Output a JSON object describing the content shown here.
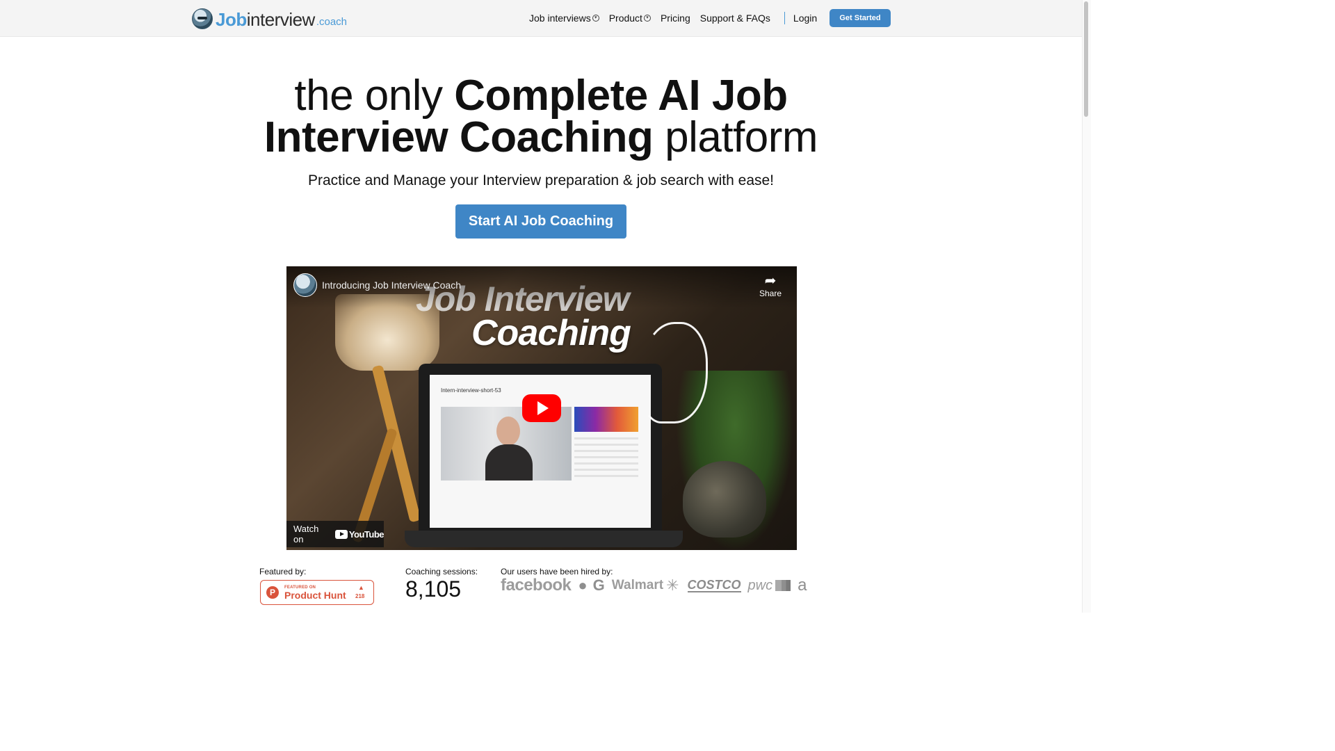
{
  "header": {
    "logo": {
      "part1": "Job",
      "part2": "interview",
      "part3": ".coach"
    },
    "nav": [
      {
        "label": "Job interviews",
        "has_dropdown": true
      },
      {
        "label": "Product",
        "has_dropdown": true
      },
      {
        "label": "Pricing",
        "has_dropdown": false
      },
      {
        "label": "Support & FAQs",
        "has_dropdown": false
      }
    ],
    "login_label": "Login",
    "cta_label": "Get Started"
  },
  "hero": {
    "title_line1_normal": "the only ",
    "title_line1_bold": "Complete AI Job",
    "title_line2_bold": "Interview Coaching",
    "title_line2_normal": " platform",
    "subtitle": "Practice and Manage your Interview preparation & job search with ease!",
    "cta_label": "Start AI Job Coaching"
  },
  "video": {
    "title": "Introducing Job Interview Coach",
    "overlay_line1": "Job Interview",
    "overlay_line2": "Coaching",
    "share_label": "Share",
    "watch_on_label": "Watch on",
    "youtube_label": "YouTube",
    "screen_title": "Intern-interview-short-53"
  },
  "stats": {
    "featured_label": "Featured by:",
    "producthunt": {
      "featured_on": "FEATURED ON",
      "name": "Product Hunt",
      "count": "218"
    },
    "sessions_label": "Coaching sessions:",
    "sessions_value": "8,105",
    "hired_label": "Our users have been hired by:",
    "companies": {
      "facebook": "facebook",
      "walmart": "Walmart",
      "costco": "COSTCO",
      "pwc": "pwc",
      "amazon": "a"
    }
  },
  "colors": {
    "accent": "#3f86c6",
    "brand_blue": "#4a9ad6",
    "producthunt": "#d9533b"
  }
}
